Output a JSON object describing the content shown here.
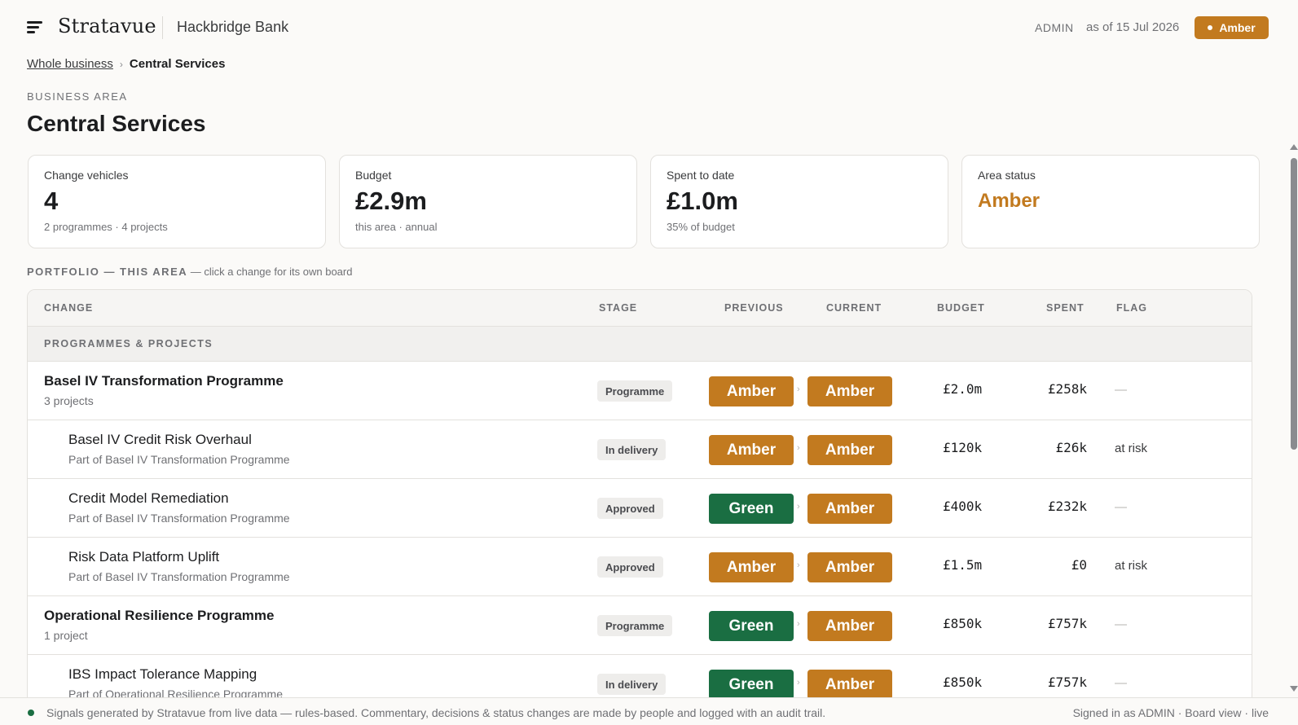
{
  "header": {
    "brand": "Stratavue",
    "bank": "Hackbridge Bank",
    "role": "ADMIN",
    "as_of": "as of 15 Jul 2026",
    "status": "Amber"
  },
  "breadcrumb": {
    "parent": "Whole business",
    "separator": "›",
    "current": "Central Services"
  },
  "page": {
    "eyebrow": "BUSINESS AREA",
    "title": "Central Services"
  },
  "stats": [
    {
      "label": "Change vehicles",
      "value": "4",
      "sub": "2 programmes · 4 projects"
    },
    {
      "label": "Budget",
      "value": "£2.9m",
      "sub": "this area · annual"
    },
    {
      "label": "Spent to date",
      "value": "£1.0m",
      "sub": "35% of budget"
    },
    {
      "label": "Area status",
      "value": "Amber",
      "sub": ""
    }
  ],
  "portfolio": {
    "label_caps": "PORTFOLIO — THIS AREA",
    "label_hint": "— click a change for its own board"
  },
  "table": {
    "columns": {
      "change": "CHANGE",
      "stage": "STAGE",
      "previous": "PREVIOUS",
      "current": "CURRENT",
      "budget": "BUDGET",
      "spent": "SPENT",
      "flag": "FLAG"
    },
    "group": "PROGRAMMES & PROJECTS",
    "arrow": "›",
    "rows": [
      {
        "name": "Basel IV Transformation Programme",
        "sub": "3 projects",
        "stage": "Programme",
        "previous": "Amber",
        "current": "Amber",
        "budget": "£2.0m",
        "spent": "£258k",
        "flag": "—"
      },
      {
        "name": "Basel IV Credit Risk Overhaul",
        "sub": "Part of Basel IV Transformation Programme",
        "stage": "In delivery",
        "previous": "Amber",
        "current": "Amber",
        "budget": "£120k",
        "spent": "£26k",
        "flag": "at risk"
      },
      {
        "name": "Credit Model Remediation",
        "sub": "Part of Basel IV Transformation Programme",
        "stage": "Approved",
        "previous": "Green",
        "current": "Amber",
        "budget": "£400k",
        "spent": "£232k",
        "flag": "—"
      },
      {
        "name": "Risk Data Platform Uplift",
        "sub": "Part of Basel IV Transformation Programme",
        "stage": "Approved",
        "previous": "Amber",
        "current": "Amber",
        "budget": "£1.5m",
        "spent": "£0",
        "flag": "at risk"
      },
      {
        "name": "Operational Resilience Programme",
        "sub": "1 project",
        "stage": "Programme",
        "previous": "Green",
        "current": "Amber",
        "budget": "£850k",
        "spent": "£757k",
        "flag": "—"
      },
      {
        "name": "IBS Impact Tolerance Mapping",
        "sub": "Part of Operational Resilience Programme",
        "stage": "In delivery",
        "previous": "Green",
        "current": "Amber",
        "budget": "£850k",
        "spent": "£757k",
        "flag": "—"
      }
    ]
  },
  "footer": {
    "note": "Signals generated by Stratavue from live data — rules-based. Commentary, decisions & status changes are made by people and logged with an audit trail.",
    "session": "Signed in as ADMIN · Board view · live"
  },
  "colors": {
    "amber": "#c27a1f",
    "green": "#1a6e42"
  }
}
